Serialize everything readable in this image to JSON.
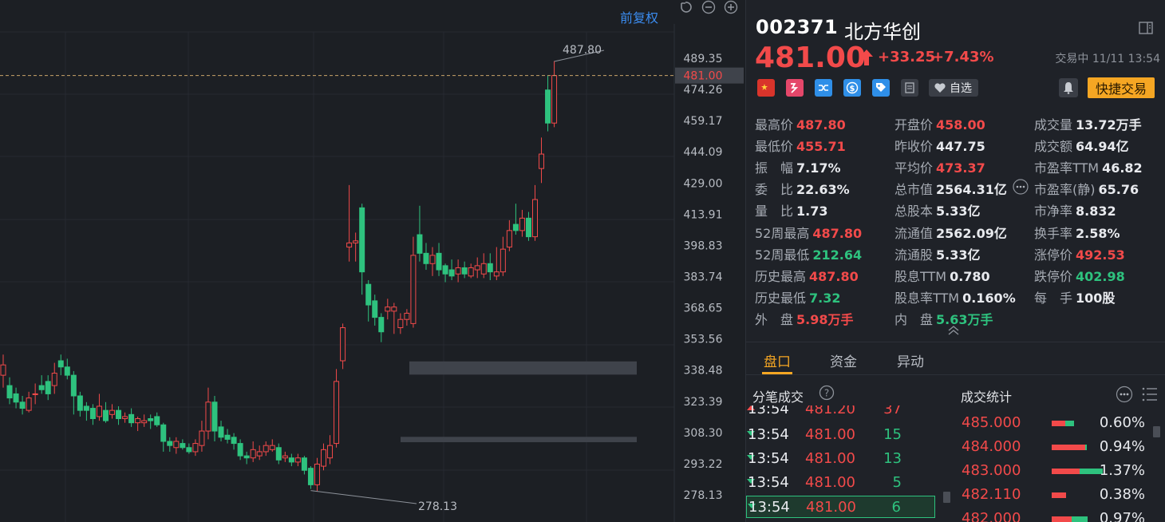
{
  "chart": {
    "adjust_label": "前复权",
    "price_axis": [
      "489.35",
      "474.26",
      "459.17",
      "444.09",
      "429.00",
      "413.91",
      "398.83",
      "383.74",
      "368.65",
      "353.56",
      "338.48",
      "323.39",
      "308.30",
      "293.22",
      "278.13"
    ],
    "current_price_tag": "481.00",
    "high_label": "487.80",
    "low_label": "278.13",
    "colors": {
      "up": "#f24a4a",
      "down": "#2ec27e",
      "bg": "#1c1f24"
    }
  },
  "header": {
    "code": "002371",
    "name": "北方华创",
    "price": "481.00",
    "change_abs": "+33.25",
    "change_pct": "+7.43%",
    "status": "交易中 11/11 13:54"
  },
  "toolbar": {
    "watch_label": "自选",
    "quick_trade_label": "快捷交易",
    "tags": [
      "flag-cn-icon",
      "margin-icon",
      "connect-icon",
      "dollar-icon",
      "tag-icon",
      "news-icon"
    ]
  },
  "stats": {
    "col1": [
      {
        "label": "最高价",
        "value": "487.80",
        "color": "red"
      },
      {
        "label": "最低价",
        "value": "455.71",
        "color": "red"
      },
      {
        "label": "振　幅",
        "value": "7.17%",
        "color": "white"
      },
      {
        "label": "委　比",
        "value": "22.63%",
        "color": "white"
      },
      {
        "label": "量　比",
        "value": "1.73",
        "color": "white"
      },
      {
        "label": "52周最高",
        "value": "487.80",
        "color": "red"
      },
      {
        "label": "52周最低",
        "value": "212.64",
        "color": "green"
      },
      {
        "label": "历史最高",
        "value": "487.80",
        "color": "red"
      },
      {
        "label": "历史最低",
        "value": "7.32",
        "color": "green"
      },
      {
        "label": "外　盘",
        "value": "5.98万手",
        "color": "red"
      }
    ],
    "col2": [
      {
        "label": "开盘价",
        "value": "458.00",
        "color": "red"
      },
      {
        "label": "昨收价",
        "value": "447.75",
        "color": "white"
      },
      {
        "label": "平均价",
        "value": "473.37",
        "color": "red"
      },
      {
        "label": "总市值",
        "value": "2564.31亿",
        "color": "white"
      },
      {
        "label": "总股本",
        "value": "5.33亿",
        "color": "white"
      },
      {
        "label": "流通值",
        "value": "2562.09亿",
        "color": "white"
      },
      {
        "label": "流通股",
        "value": "5.33亿",
        "color": "white"
      },
      {
        "label": "股息TTM",
        "value": "0.780",
        "color": "white"
      },
      {
        "label": "股息率TTM",
        "value": "0.160%",
        "color": "white"
      },
      {
        "label": "内　盘",
        "value": "5.63万手",
        "color": "green"
      }
    ],
    "col3": [
      {
        "label": "成交量",
        "value": "13.72万手",
        "color": "white"
      },
      {
        "label": "成交额",
        "value": "64.94亿",
        "color": "white"
      },
      {
        "label": "市盈率TTM",
        "value": "46.82",
        "color": "white"
      },
      {
        "label": "市盈率(静)",
        "value": "65.76",
        "color": "white"
      },
      {
        "label": "市净率",
        "value": "8.832",
        "color": "white"
      },
      {
        "label": "换手率",
        "value": "2.58%",
        "color": "white"
      },
      {
        "label": "涨停价",
        "value": "492.53",
        "color": "red"
      },
      {
        "label": "跌停价",
        "value": "402.98",
        "color": "green"
      },
      {
        "label": "每　手",
        "value": "100股",
        "color": "white"
      }
    ]
  },
  "tabs": [
    "盘口",
    "资金",
    "异动"
  ],
  "trades": {
    "title": "分笔成交",
    "rows": [
      {
        "time": "13:54",
        "price": "481.20",
        "vol": "37",
        "dir": "up"
      },
      {
        "time": "13:54",
        "price": "481.00",
        "vol": "15",
        "dir": "down"
      },
      {
        "time": "13:54",
        "price": "481.00",
        "vol": "13",
        "dir": "down"
      },
      {
        "time": "13:54",
        "price": "481.00",
        "vol": "5",
        "dir": "down"
      },
      {
        "time": "13:54",
        "price": "481.00",
        "vol": "6",
        "dir": "down"
      }
    ]
  },
  "volume_stats": {
    "title": "成交统计",
    "rows": [
      {
        "price": "485.000",
        "ratio": "0.60%",
        "share": 0.6,
        "buy_frac": 0.6
      },
      {
        "price": "484.000",
        "ratio": "0.94%",
        "share": 0.94,
        "buy_frac": 0.95
      },
      {
        "price": "483.000",
        "ratio": "1.37%",
        "share": 1.37,
        "buy_frac": 0.55
      },
      {
        "price": "482.110",
        "ratio": "0.38%",
        "share": 0.38,
        "buy_frac": 1.0
      },
      {
        "price": "482.000",
        "ratio": "0.97%",
        "share": 0.97,
        "buy_frac": 0.55
      }
    ]
  }
}
